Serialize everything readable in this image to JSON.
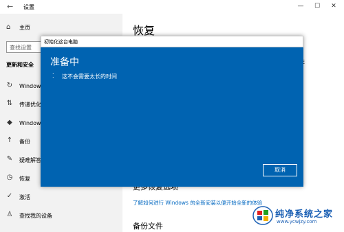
{
  "window": {
    "title": "设置",
    "back_glyph": "←",
    "minimize_glyph": "—",
    "maximize_glyph": "☐",
    "close_glyph": "✕"
  },
  "sidebar": {
    "home_label": "主页",
    "search_placeholder": "查找设置",
    "section_title": "更新和安全",
    "items": [
      {
        "label": "Windows",
        "icon": "sync-icon",
        "glyph": "↻"
      },
      {
        "label": "传递优化",
        "icon": "delivery-icon",
        "glyph": "⇅"
      },
      {
        "label": "Windows",
        "icon": "shield-icon",
        "glyph": "◆"
      },
      {
        "label": "备份",
        "icon": "backup-icon",
        "glyph": "↑"
      },
      {
        "label": "疑难解答",
        "icon": "wrench-icon",
        "glyph": "✎"
      },
      {
        "label": "恢复",
        "icon": "recovery-icon",
        "glyph": "◷"
      },
      {
        "label": "激活",
        "icon": "check-circle-icon",
        "glyph": "✓"
      },
      {
        "label": "查找我的设备",
        "icon": "person-icon",
        "glyph": "♙"
      }
    ]
  },
  "main": {
    "heading": "恢复",
    "more_options": "更多恢复选项",
    "link_text": "了解如何进行 Windows 的全新安装以便开始全新的体验",
    "backup_files": "备份文件",
    "right_snippet": "E"
  },
  "dialog": {
    "title": "初始化这台电脑",
    "heading": "准备中",
    "message": "这不会需要太长的时间",
    "cancel_label": "取消",
    "bg_color": "#0063b1"
  },
  "watermark": {
    "brand": "纯净系统之家",
    "url": "www.ycwjzy.com"
  }
}
